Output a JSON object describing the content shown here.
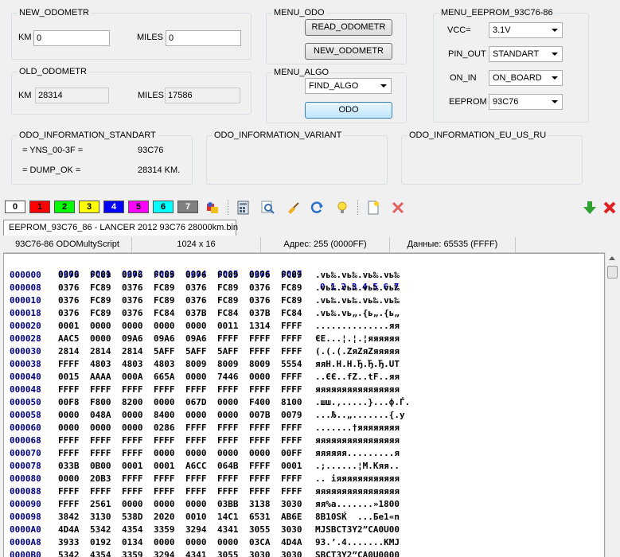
{
  "new_odometr": {
    "title": "NEW_ODOMETR",
    "km_label": "KM",
    "km_value": "0",
    "miles_label": "MILES",
    "miles_value": "0"
  },
  "old_odometr": {
    "title": "OLD_ODOMETR",
    "km_label": "KM",
    "km_value": "28314",
    "miles_label": "MILES",
    "miles_value": "17586"
  },
  "menu_odo": {
    "title": "MENU_ODO",
    "read_label": "READ_ODOMETR",
    "new_label": "NEW_ODOMETR"
  },
  "menu_algo": {
    "title": "MENU_ALGO",
    "algo_value": "FIND_ALGO",
    "odo_label": "ODO"
  },
  "menu_eeprom": {
    "title": "MENU_EEPROM_93C76-86",
    "vcc_label": "VCC=",
    "vcc_value": "3.1V",
    "pinout_label": "PIN_OUT",
    "pinout_value": "STANDART",
    "onin_label": "ON_IN",
    "onin_value": "ON_BOARD",
    "eeprom_label": "EEPROM",
    "eeprom_value": "93C76"
  },
  "info_standart": {
    "title": "ODO_INFORMATION_STANDART",
    "line1_key": "= YNS_00-3F =",
    "line1_val": "93C76",
    "line2_key": "= DUMP_OK =",
    "line2_val": "28314 KM."
  },
  "info_variant": {
    "title": "ODO_INFORMATION_VARIANT"
  },
  "info_eu": {
    "title": "ODO_INFORMATION_EU_US_RU"
  },
  "toolbar": {
    "color_boxes": [
      {
        "label": "0",
        "bg": "#ffffff",
        "fg": "#000000"
      },
      {
        "label": "1",
        "bg": "#ff0000",
        "fg": "#000000"
      },
      {
        "label": "2",
        "bg": "#00ff00",
        "fg": "#000000"
      },
      {
        "label": "3",
        "bg": "#ffff00",
        "fg": "#000000"
      },
      {
        "label": "4",
        "bg": "#0000ff",
        "fg": "#ffffff"
      },
      {
        "label": "5",
        "bg": "#ff00ff",
        "fg": "#000000"
      },
      {
        "label": "6",
        "bg": "#00ffff",
        "fg": "#000000"
      },
      {
        "label": "7",
        "bg": "#808080",
        "fg": "#ffffff"
      }
    ]
  },
  "tab": {
    "label": "EEPROM_93C76_86 - LANCER 2012 93C76 28000km.bin"
  },
  "status": {
    "script": "93C76-86  ODOMultyScript",
    "size": "1024 x 16",
    "address": "Адрес: 255 (0000FF)",
    "data": "Данные: 65535 (FFFF)"
  },
  "hex": {
    "header_cols": [
      "0000",
      "0001",
      "0002",
      "0003",
      "0004",
      "0005",
      "0006",
      "0007"
    ],
    "header_ascii": "0 1 2 3 4 5 6 7",
    "rows": [
      {
        "addr": "000000",
        "cells": [
          "0376",
          "FC89",
          "0376",
          "FC89",
          "0376",
          "FC89",
          "0376",
          "FC89"
        ],
        "ascii": ".vь‰.vь‰.vь‰.vь‰"
      },
      {
        "addr": "000008",
        "cells": [
          "0376",
          "FC89",
          "0376",
          "FC89",
          "0376",
          "FC89",
          "0376",
          "FC89"
        ],
        "ascii": ".vь‰.vь‰.vь‰.vь‰"
      },
      {
        "addr": "000010",
        "cells": [
          "0376",
          "FC89",
          "0376",
          "FC89",
          "0376",
          "FC89",
          "0376",
          "FC89"
        ],
        "ascii": ".vь‰.vь‰.vь‰.vь‰"
      },
      {
        "addr": "000018",
        "cells": [
          "0376",
          "FC89",
          "0376",
          "FC84",
          "037B",
          "FC84",
          "037B",
          "FC84"
        ],
        "ascii": ".vь‰.vь„.{ь„.{ь„"
      },
      {
        "addr": "000020",
        "cells": [
          "0001",
          "0000",
          "0000",
          "0000",
          "0000",
          "0011",
          "1314",
          "FFFF"
        ],
        "ascii": "..............яя"
      },
      {
        "addr": "000028",
        "cells": [
          "AAC5",
          "0000",
          "09A6",
          "09A6",
          "09A6",
          "FFFF",
          "FFFF",
          "FFFF"
        ],
        "ascii": "ЄЕ...¦.¦.¦яяяяяя"
      },
      {
        "addr": "000030",
        "cells": [
          "2814",
          "2814",
          "2814",
          "5AFF",
          "5AFF",
          "5AFF",
          "FFFF",
          "FFFF"
        ],
        "ascii": "(.(.(.ZяZяZяяяяя"
      },
      {
        "addr": "000038",
        "cells": [
          "FFFF",
          "4803",
          "4803",
          "4803",
          "8009",
          "8009",
          "8009",
          "5554"
        ],
        "ascii": "яяH.H.H.Ђ.Ђ.Ђ.UT"
      },
      {
        "addr": "000040",
        "cells": [
          "0015",
          "AAAA",
          "000A",
          "665A",
          "0000",
          "7446",
          "0000",
          "FFFF"
        ],
        "ascii": "..ЄЄ..fZ..tF..яя"
      },
      {
        "addr": "000048",
        "cells": [
          "FFFF",
          "FFFF",
          "FFFF",
          "FFFF",
          "FFFF",
          "FFFF",
          "FFFF",
          "FFFF"
        ],
        "ascii": "яяяяяяяяяяяяяяяя"
      },
      {
        "addr": "000050",
        "cells": [
          "00F8",
          "F800",
          "8200",
          "0000",
          "067D",
          "0000",
          "F400",
          "8100"
        ],
        "ascii": ".шш.‚.....}...ф.Ѓ."
      },
      {
        "addr": "000058",
        "cells": [
          "0000",
          "048A",
          "0000",
          "8400",
          "0000",
          "0000",
          "007B",
          "0079"
        ],
        "ascii": "...Љ..„.......{.y"
      },
      {
        "addr": "000060",
        "cells": [
          "0000",
          "0000",
          "0000",
          "0286",
          "FFFF",
          "FFFF",
          "FFFF",
          "FFFF"
        ],
        "ascii": ".......†яяяяяяяя"
      },
      {
        "addr": "000068",
        "cells": [
          "FFFF",
          "FFFF",
          "FFFF",
          "FFFF",
          "FFFF",
          "FFFF",
          "FFFF",
          "FFFF"
        ],
        "ascii": "яяяяяяяяяяяяяяяя"
      },
      {
        "addr": "000070",
        "cells": [
          "FFFF",
          "FFFF",
          "FFFF",
          "0000",
          "0000",
          "0000",
          "0000",
          "00FF"
        ],
        "ascii": "яяяяяя.........я"
      },
      {
        "addr": "000078",
        "cells": [
          "033B",
          "0B00",
          "0001",
          "0001",
          "A6CC",
          "064B",
          "FFFF",
          "0001"
        ],
        "ascii": ".;......¦М.Kяя.."
      },
      {
        "addr": "000080",
        "cells": [
          "0000",
          "20B3",
          "FFFF",
          "FFFF",
          "FFFF",
          "FFFF",
          "FFFF",
          "FFFF"
        ],
        "ascii": ".. іяяяяяяяяяяяя"
      },
      {
        "addr": "000088",
        "cells": [
          "FFFF",
          "FFFF",
          "FFFF",
          "FFFF",
          "FFFF",
          "FFFF",
          "FFFF",
          "FFFF"
        ],
        "ascii": "яяяяяяяяяяяяяяяя"
      },
      {
        "addr": "000090",
        "cells": [
          "FFFF",
          "2561",
          "0000",
          "0000",
          "0000",
          "03BB",
          "3138",
          "3030"
        ],
        "ascii": "яя%a.......»1800"
      },
      {
        "addr": "000098",
        "cells": [
          "3842",
          "3130",
          "538D",
          "2020",
          "0010",
          "14C1",
          "6531",
          "AB6E"
        ],
        "ascii": "8B10SЌ  ...Бe1«n"
      },
      {
        "addr": "0000A0",
        "cells": [
          "4D4A",
          "5342",
          "4354",
          "3359",
          "3294",
          "4341",
          "3055",
          "3030"
        ],
        "ascii": "MJSBCT3Y2”CA0U00"
      },
      {
        "addr": "0000A8",
        "cells": [
          "3933",
          "0192",
          "0134",
          "0000",
          "0000",
          "0000",
          "03CA",
          "4D4A"
        ],
        "ascii": "93.’.4.......КMJ"
      },
      {
        "addr": "0000B0",
        "cells": [
          "5342",
          "4354",
          "3359",
          "3294",
          "4341",
          "3055",
          "3030",
          "3030"
        ],
        "ascii": "SBCT3Y2”CA0U0000"
      }
    ]
  }
}
